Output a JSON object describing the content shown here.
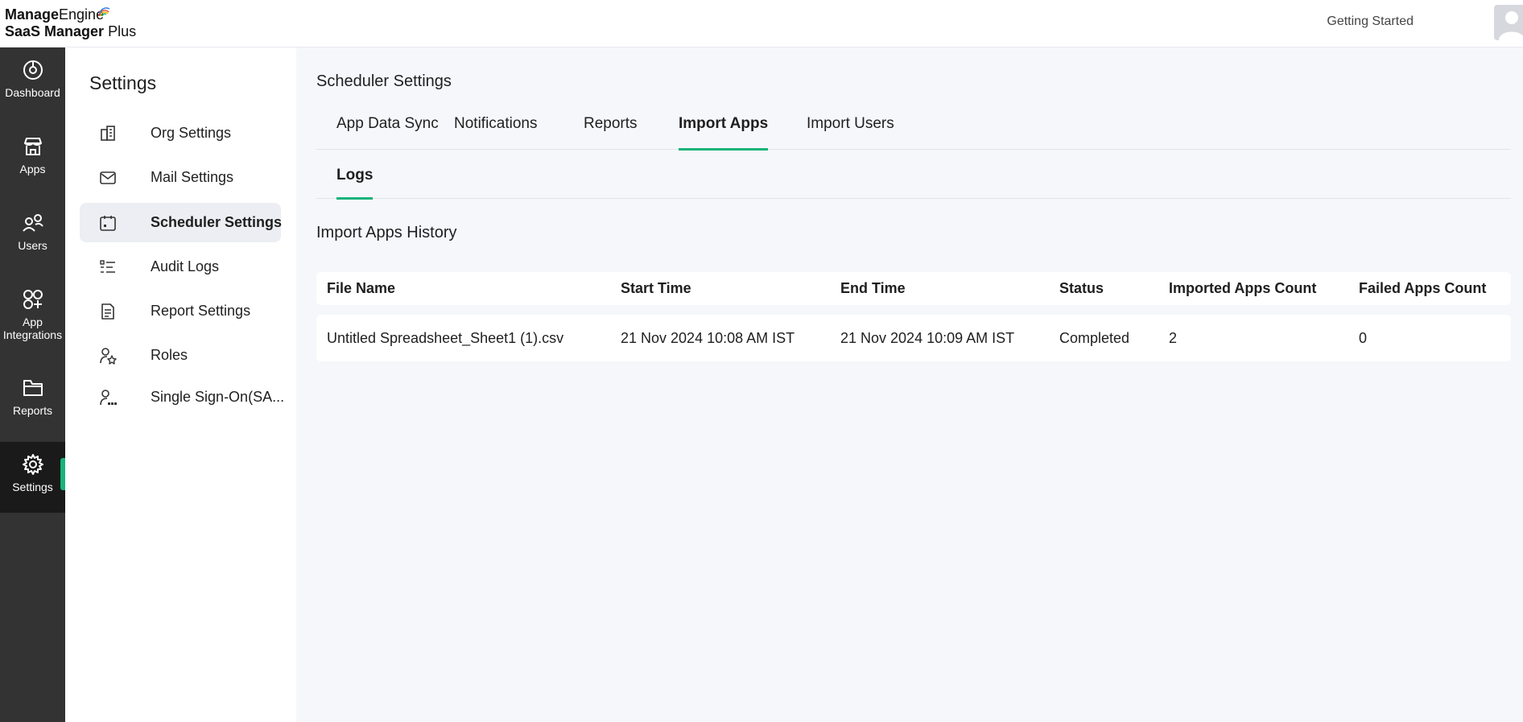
{
  "header": {
    "brand_manage": "Manage",
    "brand_engine": "Engine",
    "product_main": "SaaS Manager",
    "product_plus": "Plus",
    "getting_started": "Getting Started"
  },
  "leftnav": {
    "items": [
      {
        "label": "Dashboard",
        "icon": "dashboard-icon"
      },
      {
        "label": "Apps",
        "icon": "store-icon"
      },
      {
        "label": "Users",
        "icon": "users-icon"
      },
      {
        "label": "App Integrations",
        "icon": "integrations-icon"
      },
      {
        "label": "Reports",
        "icon": "folder-icon"
      },
      {
        "label": "Settings",
        "icon": "gear-icon"
      }
    ],
    "active": "Settings"
  },
  "settings_sidebar": {
    "title": "Settings",
    "items": [
      {
        "label": "Org Settings",
        "icon": "building-icon"
      },
      {
        "label": "Mail Settings",
        "icon": "mail-icon"
      },
      {
        "label": "Scheduler Settings",
        "icon": "calendar-icon"
      },
      {
        "label": "Audit Logs",
        "icon": "list-icon"
      },
      {
        "label": "Report Settings",
        "icon": "document-icon"
      },
      {
        "label": "Roles",
        "icon": "user-star-icon"
      },
      {
        "label": "Single Sign-On(SA...",
        "icon": "user-dots-icon"
      }
    ],
    "active": "Scheduler Settings"
  },
  "main": {
    "title": "Scheduler Settings",
    "tabs": [
      {
        "label": "App Data Sync"
      },
      {
        "label": "Notifications"
      },
      {
        "label": "Reports"
      },
      {
        "label": "Import Apps"
      },
      {
        "label": "Import Users"
      }
    ],
    "active_tab": "Import Apps",
    "subtabs": [
      {
        "label": "Logs"
      }
    ],
    "section_title": "Import Apps History",
    "table": {
      "columns": [
        "File Name",
        "Start Time",
        "End Time",
        "Status",
        "Imported Apps Count",
        "Failed Apps Count"
      ],
      "rows": [
        [
          "Untitled Spreadsheet_Sheet1 (1).csv",
          "21 Nov 2024 10:08 AM IST",
          "21 Nov 2024 10:09 AM IST",
          "Completed",
          "2",
          "0"
        ]
      ]
    }
  },
  "colors": {
    "accent": "#18b27a",
    "nav_bg": "#333333",
    "nav_active_bg": "#1a1a1a",
    "content_bg": "#f6f7fb"
  }
}
